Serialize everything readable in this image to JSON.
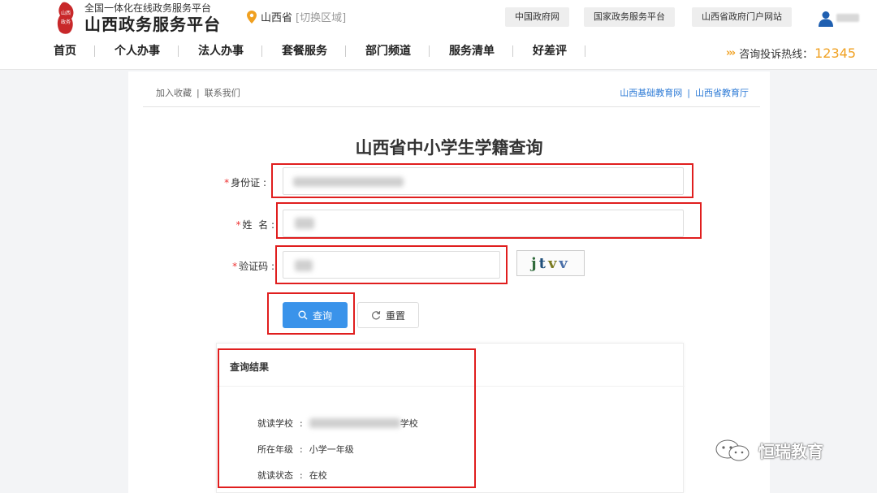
{
  "header": {
    "logo_subtitle": "全国一体化在线政务服务平台",
    "logo_title": "山西政务服务平台",
    "region": "山西省",
    "region_switch": "[切换区域]",
    "top_links": [
      "中国政府网",
      "国家政务服务平台",
      "山西省政府门户网站"
    ],
    "nav": [
      "首页",
      "个人办事",
      "法人办事",
      "套餐服务",
      "部门频道",
      "服务清单",
      "好差评"
    ],
    "hotline_label": "咨询投诉热线：",
    "hotline_number": "12345",
    "accent_color": "#f0a020"
  },
  "panel": {
    "top_left_links": [
      "加入收藏",
      "联系我们"
    ],
    "top_right_links": [
      "山西基础教育网",
      "山西省教育厅"
    ],
    "title": "山西省中小学生学籍查询",
    "fields": {
      "id_card_label": "身份证",
      "name_label": "姓  名",
      "captcha_label": "验证码"
    },
    "captcha_text": [
      "j",
      "t",
      "v",
      "v"
    ],
    "query_button": "查询",
    "reset_button": "重置",
    "primary_color": "#3a93ea"
  },
  "result": {
    "title": "查询结果",
    "school_label": "就读学校",
    "school_suffix": "学校",
    "grade_label": "所在年级",
    "grade_value": "小学一年级",
    "status_label": "就读状态",
    "status_value": "在校"
  },
  "watermark": "恒瑞教育"
}
